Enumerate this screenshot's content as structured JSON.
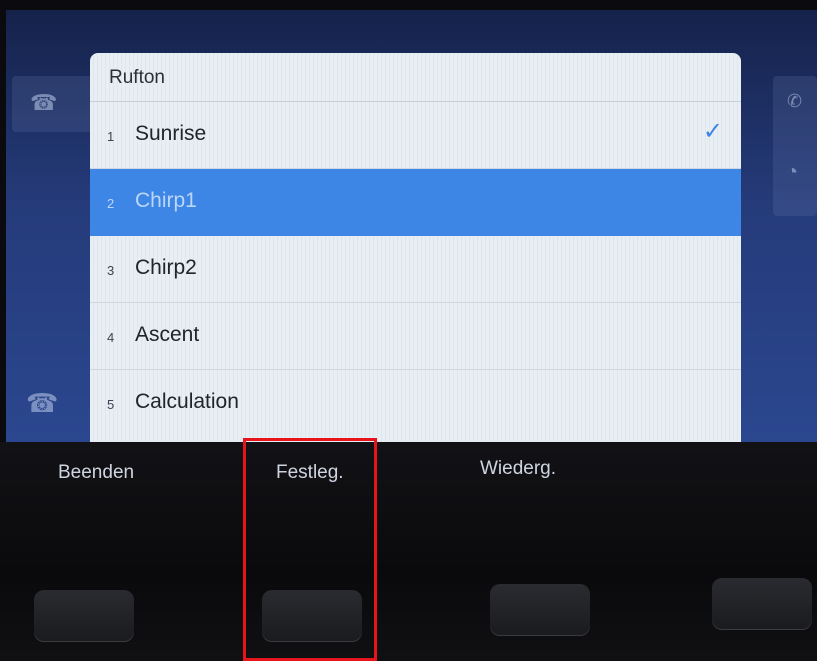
{
  "dialog": {
    "title": "Rufton",
    "items": [
      {
        "num": "1",
        "label": "Sunrise",
        "checked": true
      },
      {
        "num": "2",
        "label": "Chirp1",
        "selected": true
      },
      {
        "num": "3",
        "label": "Chirp2"
      },
      {
        "num": "4",
        "label": "Ascent"
      },
      {
        "num": "5",
        "label": "Calculation"
      }
    ],
    "check_icon": "checkmark-icon"
  },
  "softkeys": {
    "quit_label": "Beenden",
    "set_label": "Festleg.",
    "play_label": "Wiederg."
  },
  "colors": {
    "selection": "#3d86e6",
    "highlight": "#e8141b"
  }
}
